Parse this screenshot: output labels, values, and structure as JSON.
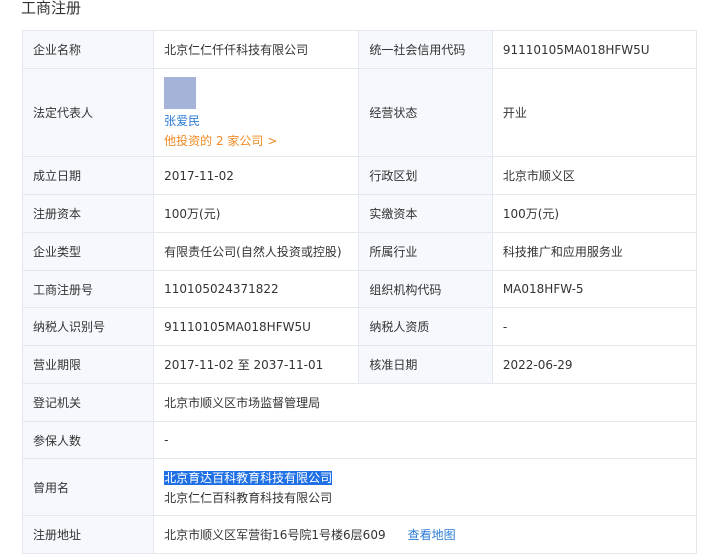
{
  "section_title": "工商注册",
  "rows": [
    {
      "l1": "企业名称",
      "v1": "北京仁仁仟仟科技有限公司",
      "l2": "统一社会信用代码",
      "v2": "91110105MA018HFW5U"
    },
    {
      "l1": "法定代表人",
      "l2": "经营状态",
      "v2": "开业"
    },
    {
      "l1": "成立日期",
      "v1": "2017-11-02",
      "l2": "行政区划",
      "v2": "北京市顺义区"
    },
    {
      "l1": "注册资本",
      "v1": "100万(元)",
      "l2": "实缴资本",
      "v2": "100万(元)"
    },
    {
      "l1": "企业类型",
      "v1": "有限责任公司(自然人投资或控股)",
      "l2": "所属行业",
      "v2": "科技推广和应用服务业"
    },
    {
      "l1": "工商注册号",
      "v1": "110105024371822",
      "l2": "组织机构代码",
      "v2": "MA018HFW-5"
    },
    {
      "l1": "纳税人识别号",
      "v1": "91110105MA018HFW5U",
      "l2": "纳税人资质",
      "v2": "-"
    },
    {
      "l1": "营业期限",
      "v1": "2017-11-02 至 2037-11-01",
      "l2": "核准日期",
      "v2": "2022-06-29"
    },
    {
      "l1": "登记机关",
      "v1": "北京市顺义区市场监督管理局"
    },
    {
      "l1": "参保人数",
      "v1": "-"
    },
    {
      "l1": "曾用名"
    },
    {
      "l1": "注册地址",
      "v1": "北京市顺义区军营街16号院1号楼6层609"
    }
  ],
  "legal_rep": {
    "name": "张爱民",
    "link": "他投资的 2 家公司 >"
  },
  "former_names": [
    "北京育达百科教育科技有限公司",
    "北京仁仁百科教育科技有限公司"
  ],
  "map_link": "查看地图"
}
